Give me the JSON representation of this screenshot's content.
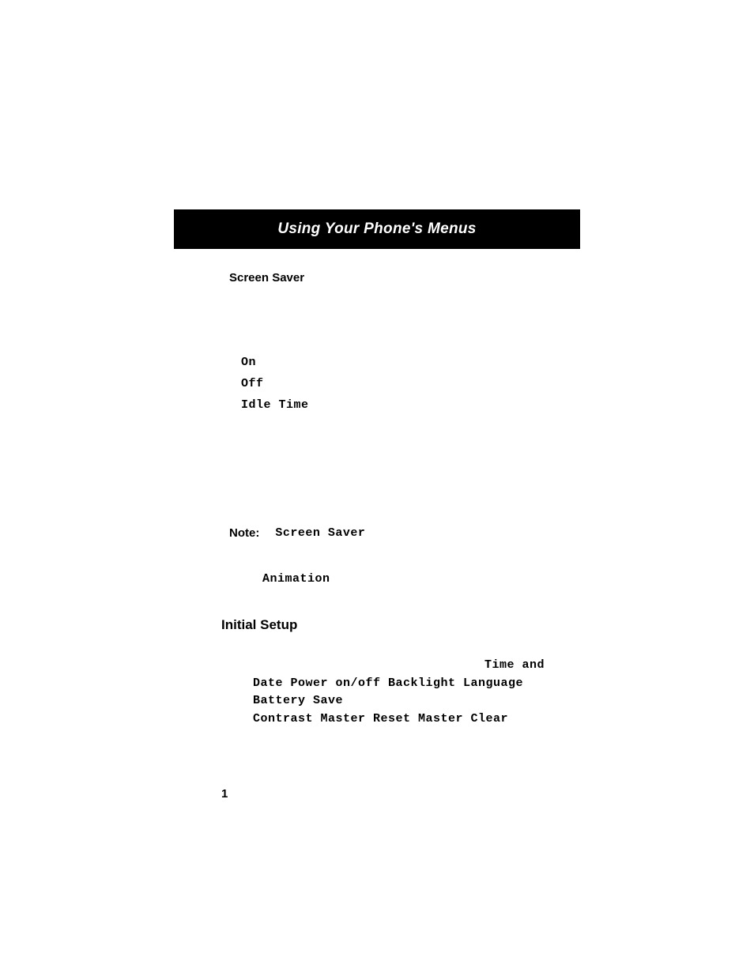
{
  "title": "Using Your Phone's Menus",
  "headings": {
    "screen_saver": "Screen Saver",
    "initial_setup": "Initial Setup"
  },
  "options": {
    "on": "On",
    "off": "Off",
    "idle_time": "Idle Time"
  },
  "note": {
    "label": "Note:",
    "value": "Screen Saver"
  },
  "animation": "Animation",
  "setup_items": {
    "line1_right": "Time and",
    "line2": "Date Power on/off Backlight Language Battery Save",
    "line3": "Contrast Master Reset Master Clear"
  },
  "page_number": "1"
}
